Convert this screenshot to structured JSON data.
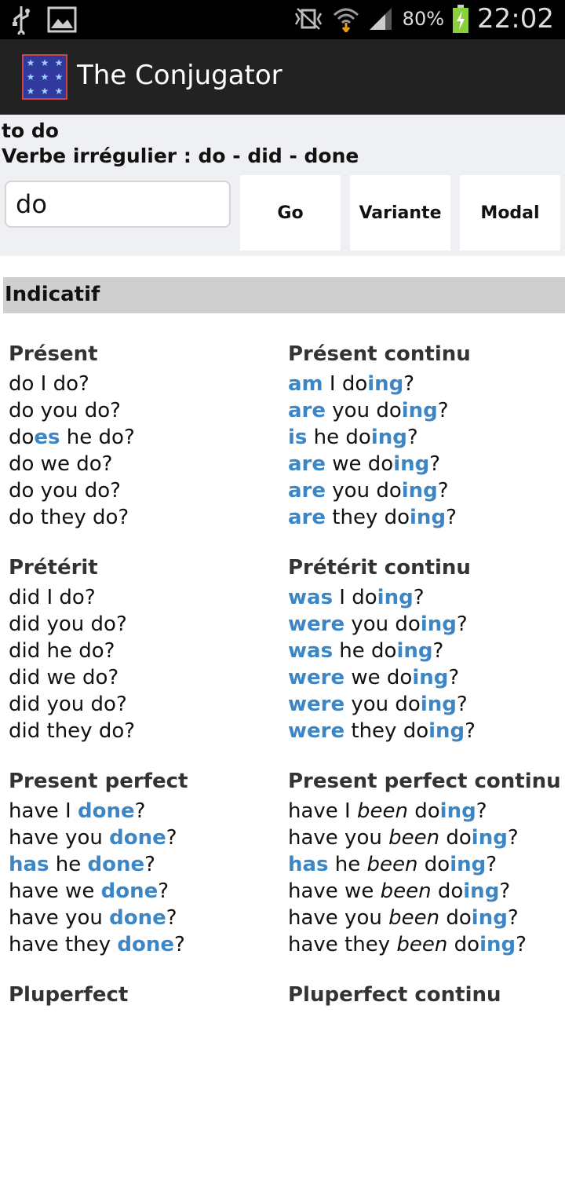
{
  "status": {
    "battery": "80%",
    "time": "22:02"
  },
  "app": {
    "title": "The Conjugator"
  },
  "verb": {
    "infinitive": "to do",
    "info": "Verbe irrégulier : do - did - done"
  },
  "search": {
    "value": "do"
  },
  "buttons": {
    "go": "Go",
    "variante": "Variante",
    "modal": "Modal"
  },
  "section": {
    "title": "Indicatif"
  },
  "colors": {
    "accent": "#3d86c6",
    "actionbar": "#222222",
    "section_bg": "#cfcfcf"
  },
  "left": [
    {
      "title": "Présent",
      "lines": [
        [
          [
            "do I do?",
            ""
          ]
        ],
        [
          [
            "do you do?",
            ""
          ]
        ],
        [
          [
            "do",
            ""
          ],
          [
            "es",
            "b"
          ],
          [
            " he do?",
            ""
          ]
        ],
        [
          [
            "do we do?",
            ""
          ]
        ],
        [
          [
            "do you do?",
            ""
          ]
        ],
        [
          [
            "do they do?",
            ""
          ]
        ]
      ]
    },
    {
      "title": "Prétérit",
      "lines": [
        [
          [
            "did I do?",
            ""
          ]
        ],
        [
          [
            "did you do?",
            ""
          ]
        ],
        [
          [
            "did he do?",
            ""
          ]
        ],
        [
          [
            "did we do?",
            ""
          ]
        ],
        [
          [
            "did you do?",
            ""
          ]
        ],
        [
          [
            "did they do?",
            ""
          ]
        ]
      ]
    },
    {
      "title": "Present perfect",
      "lines": [
        [
          [
            "have I ",
            ""
          ],
          [
            "done",
            "b"
          ],
          [
            "?",
            ""
          ]
        ],
        [
          [
            "have you ",
            ""
          ],
          [
            "done",
            "b"
          ],
          [
            "?",
            ""
          ]
        ],
        [
          [
            "has",
            "b"
          ],
          [
            " he ",
            ""
          ],
          [
            "done",
            "b"
          ],
          [
            "?",
            ""
          ]
        ],
        [
          [
            "have we ",
            ""
          ],
          [
            "done",
            "b"
          ],
          [
            "?",
            ""
          ]
        ],
        [
          [
            "have you ",
            ""
          ],
          [
            "done",
            "b"
          ],
          [
            "?",
            ""
          ]
        ],
        [
          [
            "have they ",
            ""
          ],
          [
            "done",
            "b"
          ],
          [
            "?",
            ""
          ]
        ]
      ]
    },
    {
      "title": "Pluperfect",
      "lines": []
    }
  ],
  "right": [
    {
      "title": "Présent continu",
      "lines": [
        [
          [
            "am",
            "b"
          ],
          [
            " I do",
            ""
          ],
          [
            "ing",
            "b"
          ],
          [
            "?",
            ""
          ]
        ],
        [
          [
            "are",
            "b"
          ],
          [
            " you do",
            ""
          ],
          [
            "ing",
            "b"
          ],
          [
            "?",
            ""
          ]
        ],
        [
          [
            "is",
            "b"
          ],
          [
            " he do",
            ""
          ],
          [
            "ing",
            "b"
          ],
          [
            "?",
            ""
          ]
        ],
        [
          [
            "are",
            "b"
          ],
          [
            " we do",
            ""
          ],
          [
            "ing",
            "b"
          ],
          [
            "?",
            ""
          ]
        ],
        [
          [
            "are",
            "b"
          ],
          [
            " you do",
            ""
          ],
          [
            "ing",
            "b"
          ],
          [
            "?",
            ""
          ]
        ],
        [
          [
            "are",
            "b"
          ],
          [
            " they do",
            ""
          ],
          [
            "ing",
            "b"
          ],
          [
            "?",
            ""
          ]
        ]
      ]
    },
    {
      "title": "Prétérit continu",
      "lines": [
        [
          [
            "was",
            "b"
          ],
          [
            " I do",
            ""
          ],
          [
            "ing",
            "b"
          ],
          [
            "?",
            ""
          ]
        ],
        [
          [
            "were",
            "b"
          ],
          [
            " you do",
            ""
          ],
          [
            "ing",
            "b"
          ],
          [
            "?",
            ""
          ]
        ],
        [
          [
            "was",
            "b"
          ],
          [
            " he do",
            ""
          ],
          [
            "ing",
            "b"
          ],
          [
            "?",
            ""
          ]
        ],
        [
          [
            "were",
            "b"
          ],
          [
            " we do",
            ""
          ],
          [
            "ing",
            "b"
          ],
          [
            "?",
            ""
          ]
        ],
        [
          [
            "were",
            "b"
          ],
          [
            " you do",
            ""
          ],
          [
            "ing",
            "b"
          ],
          [
            "?",
            ""
          ]
        ],
        [
          [
            "were",
            "b"
          ],
          [
            " they do",
            ""
          ],
          [
            "ing",
            "b"
          ],
          [
            "?",
            ""
          ]
        ]
      ]
    },
    {
      "title": "Present perfect continu",
      "lines": [
        [
          [
            "have I ",
            ""
          ],
          [
            "been",
            "it"
          ],
          [
            " do",
            ""
          ],
          [
            "ing",
            "b"
          ],
          [
            "?",
            ""
          ]
        ],
        [
          [
            "have you ",
            ""
          ],
          [
            "been",
            "it"
          ],
          [
            " do",
            ""
          ],
          [
            "ing",
            "b"
          ],
          [
            "?",
            ""
          ]
        ],
        [
          [
            "has",
            "b"
          ],
          [
            " he ",
            ""
          ],
          [
            "been",
            "it"
          ],
          [
            " do",
            ""
          ],
          [
            "ing",
            "b"
          ],
          [
            "?",
            ""
          ]
        ],
        [
          [
            "have we ",
            ""
          ],
          [
            "been",
            "it"
          ],
          [
            " do",
            ""
          ],
          [
            "ing",
            "b"
          ],
          [
            "?",
            ""
          ]
        ],
        [
          [
            "have you ",
            ""
          ],
          [
            "been",
            "it"
          ],
          [
            " do",
            ""
          ],
          [
            "ing",
            "b"
          ],
          [
            "?",
            ""
          ]
        ],
        [
          [
            "have they ",
            ""
          ],
          [
            "been",
            "it"
          ],
          [
            " do",
            ""
          ],
          [
            "ing",
            "b"
          ],
          [
            "?",
            ""
          ]
        ]
      ]
    },
    {
      "title": "Pluperfect continu",
      "lines": []
    }
  ]
}
